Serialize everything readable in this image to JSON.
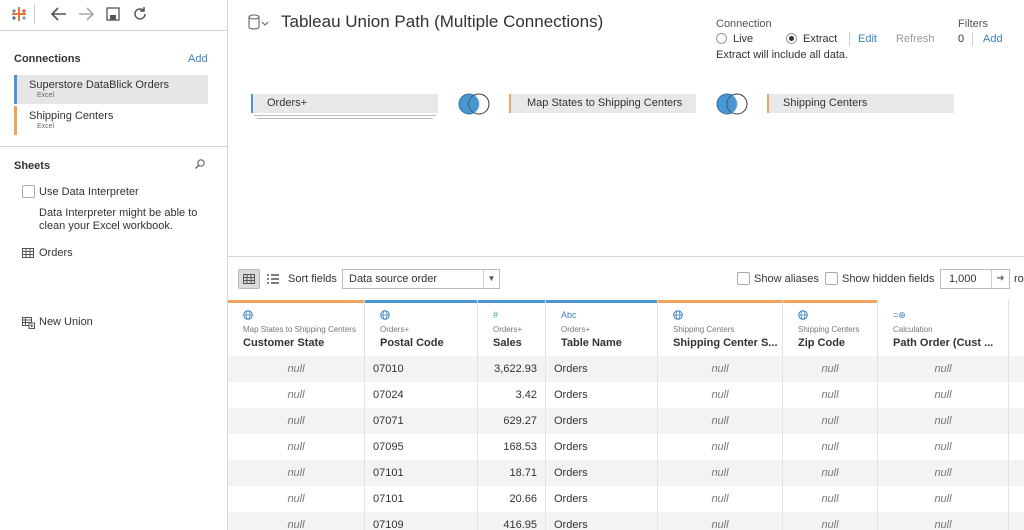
{
  "toolbar": {
    "icons": [
      "tableau-logo-icon",
      "back-icon",
      "forward-icon",
      "save-icon",
      "refresh-icon"
    ]
  },
  "connections": {
    "title": "Connections",
    "add_label": "Add",
    "items": [
      {
        "name": "Superstore DataBlick Orders",
        "type": "Excel",
        "color": "#4996d1"
      },
      {
        "name": "Shipping Centers",
        "type": "Excel",
        "color": "#f0a35c"
      }
    ]
  },
  "sheets": {
    "title": "Sheets",
    "use_interpreter": "Use Data Interpreter",
    "interpreter_note_1": "Data Interpreter might be able to",
    "interpreter_note_2": "clean your Excel workbook.",
    "items": [
      "Orders"
    ],
    "new_union": "New Union"
  },
  "datasource": {
    "title": "Tableau Union Path (Multiple Connections)"
  },
  "connection": {
    "label": "Connection",
    "live": "Live",
    "extract": "Extract",
    "selected": "Extract",
    "edit": "Edit",
    "refresh": "Refresh",
    "note": "Extract will include all data."
  },
  "filters": {
    "label": "Filters",
    "count": "0",
    "add": "Add"
  },
  "join_flow": {
    "tables": [
      "Orders+",
      "Map States to Shipping Centers",
      "Shipping Centers"
    ]
  },
  "grid_bar": {
    "sort_label": "Sort fields",
    "sort_value": "Data source order",
    "show_aliases": "Show aliases",
    "show_hidden": "Show hidden fields",
    "rows_value": "1,000",
    "rows_suffix": "ro"
  },
  "columns": [
    {
      "icon": "globe-icon",
      "source": "Map States to Shipping Centers",
      "name": "Customer State",
      "color": "#f0a35c"
    },
    {
      "icon": "globe-icon",
      "source": "Orders+",
      "name": "Postal Code",
      "color": "#4996d1"
    },
    {
      "icon": "number-icon",
      "source": "Orders+",
      "name": "Sales",
      "color": "#4996d1"
    },
    {
      "icon": "abc-icon",
      "source": "Orders+",
      "name": "Table Name",
      "color": "#4996d1"
    },
    {
      "icon": "globe-icon",
      "source": "Shipping Centers",
      "name": "Shipping Center S...",
      "color": "#f0a35c"
    },
    {
      "icon": "globe-icon",
      "source": "Shipping Centers",
      "name": "Zip Code",
      "color": "#f0a35c"
    },
    {
      "icon": "calc-icon",
      "source": "Calculation",
      "name": "Path Order (Cust ...",
      "color": "#ffffff"
    }
  ],
  "rows": [
    [
      "null",
      "07010",
      "3,622.93",
      "Orders",
      "null",
      "null",
      "null"
    ],
    [
      "null",
      "07024",
      "3.42",
      "Orders",
      "null",
      "null",
      "null"
    ],
    [
      "null",
      "07071",
      "629.27",
      "Orders",
      "null",
      "null",
      "null"
    ],
    [
      "null",
      "07095",
      "168.53",
      "Orders",
      "null",
      "null",
      "null"
    ],
    [
      "null",
      "07101",
      "18.71",
      "Orders",
      "null",
      "null",
      "null"
    ],
    [
      "null",
      "07101",
      "20.66",
      "Orders",
      "null",
      "null",
      "null"
    ],
    [
      "null",
      "07109",
      "416.95",
      "Orders",
      "null",
      "null",
      "null"
    ]
  ]
}
